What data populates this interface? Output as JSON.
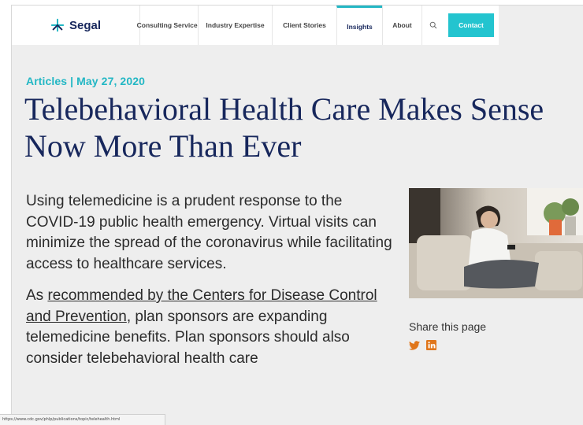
{
  "header": {
    "logo_text": "Segal",
    "nav": [
      "Consulting Services",
      "Industry Expertise",
      "Client Stories",
      "Insights",
      "About"
    ],
    "active_nav": "Insights",
    "search_icon": "search-icon",
    "contact_label": "Contact"
  },
  "article": {
    "meta": "Articles | May 27, 2020",
    "title": "Telebehavioral Health Care Makes Sense Now More Than Ever",
    "para1": "Using telemedicine is a prudent response to the COVID-19 public health emergency. Virtual visits can minimize the spread of the coronavirus while facilitating access to healthcare services.",
    "para2_prefix": "As ",
    "para2_link": "recommended by the Centers for Disease Control and Prevention",
    "para2_suffix": ", plan sponsors are expanding telemedicine benefits. Plan sponsors should also consider telebehavioral health care"
  },
  "sidebar": {
    "share_label": "Share this page",
    "icons": [
      "twitter-icon",
      "linkedin-icon"
    ]
  },
  "colors": {
    "navy": "#17275c",
    "teal": "#23b7c4",
    "social": "#e0761b"
  },
  "statusbar": {
    "url": "https://www.cdc.gov/phlp/publications/topic/telehealth.html"
  }
}
